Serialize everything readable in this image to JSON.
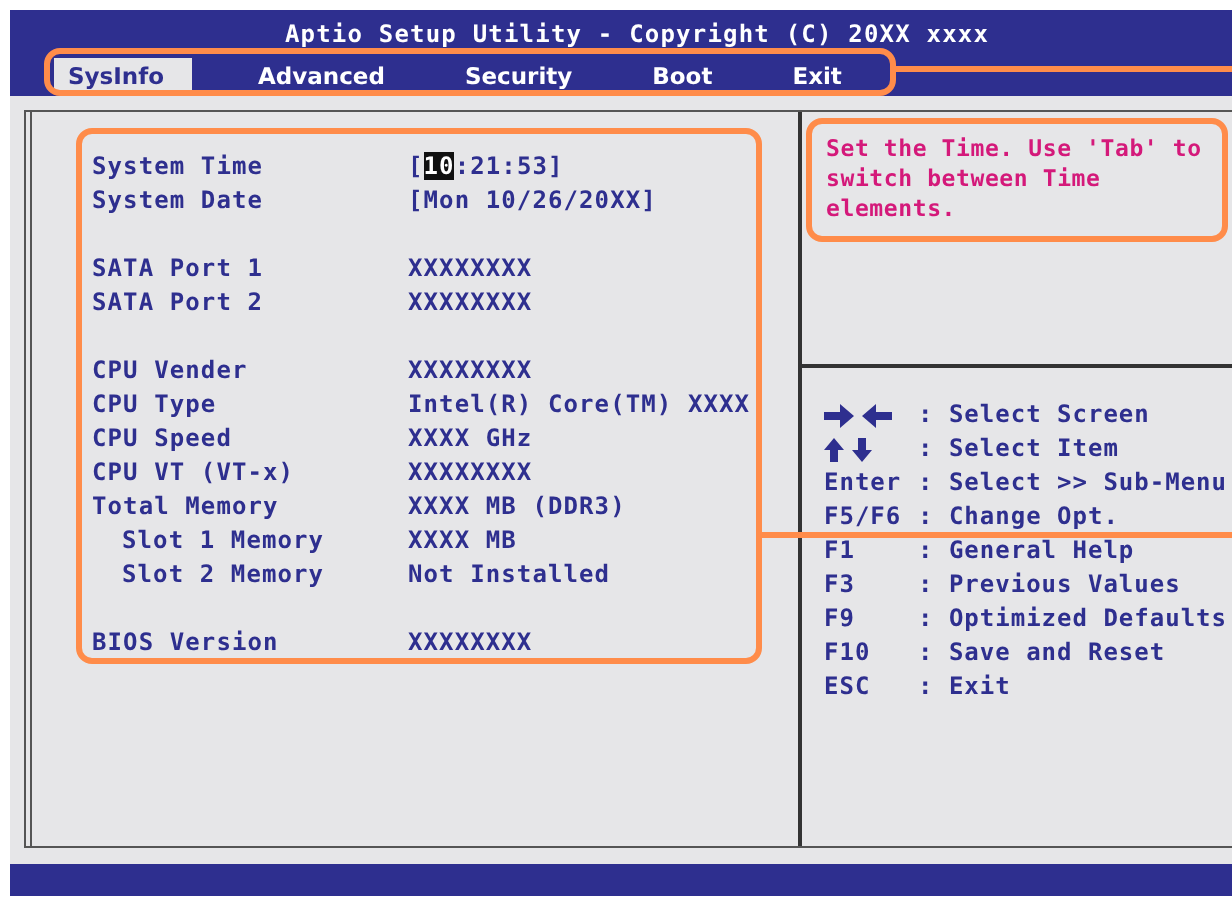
{
  "window": {
    "title": "Aptio Setup Utility - Copyright (C) 20XX xxxx"
  },
  "tabs": [
    {
      "label": "SysInfo",
      "selected": true
    },
    {
      "label": "Advanced",
      "selected": false
    },
    {
      "label": "Security",
      "selected": false
    },
    {
      "label": "Boot",
      "selected": false
    },
    {
      "label": "Exit",
      "selected": false
    }
  ],
  "info_groups": [
    [
      {
        "label": "System Time",
        "value_parts": [
          {
            "text": "[",
            "highlighted": false
          },
          {
            "text": "10",
            "highlighted": true
          },
          {
            "text": ":21:53]",
            "highlighted": false
          }
        ]
      },
      {
        "label": "System Date",
        "value_parts": [
          {
            "text": "[Mon 10/26/20XX]",
            "highlighted": false
          }
        ]
      }
    ],
    [
      {
        "label": "SATA Port 1",
        "value_parts": [
          {
            "text": "XXXXXXXX",
            "highlighted": false
          }
        ]
      },
      {
        "label": "SATA Port 2",
        "value_parts": [
          {
            "text": "XXXXXXXX",
            "highlighted": false
          }
        ]
      }
    ],
    [
      {
        "label": "CPU Vender",
        "value_parts": [
          {
            "text": "XXXXXXXX",
            "highlighted": false
          }
        ]
      },
      {
        "label": "CPU Type",
        "value_parts": [
          {
            "text": "Intel(R) Core(TM) XXXX",
            "highlighted": false
          }
        ]
      },
      {
        "label": "CPU Speed",
        "value_parts": [
          {
            "text": "XXXX GHz",
            "highlighted": false
          }
        ]
      },
      {
        "label": "CPU VT (VT-x)",
        "value_parts": [
          {
            "text": "XXXXXXXX",
            "highlighted": false
          }
        ]
      },
      {
        "label": "Total Memory",
        "value_parts": [
          {
            "text": "XXXX MB (DDR3)",
            "highlighted": false
          }
        ],
        "children": [
          {
            "label": "Slot 1 Memory",
            "value_parts": [
              {
                "text": "XXXX MB",
                "highlighted": false
              }
            ]
          },
          {
            "label": "Slot 2 Memory",
            "value_parts": [
              {
                "text": "Not Installed",
                "highlighted": false
              }
            ]
          }
        ]
      }
    ],
    [
      {
        "label": "BIOS Version",
        "value_parts": [
          {
            "text": "XXXXXXXX",
            "highlighted": false
          }
        ]
      }
    ]
  ],
  "help_text": "Set the Time. Use 'Tab' to switch between Time elements.",
  "keys": [
    {
      "kind": "arrows-horizontal",
      "action": ": Select Screen"
    },
    {
      "kind": "arrows-vertical",
      "action": ": Select Item"
    },
    {
      "kind": "text",
      "key": "Enter",
      "action": ": Select >> Sub-Menu"
    },
    {
      "kind": "text",
      "key": "F5/F6",
      "action": ": Change Opt."
    },
    {
      "kind": "text",
      "key": "F1",
      "action": ": General Help"
    },
    {
      "kind": "text",
      "key": "F3",
      "action": ": Previous Values"
    },
    {
      "kind": "text",
      "key": "F9",
      "action": ": Optimized Defaults"
    },
    {
      "kind": "text",
      "key": "F10",
      "action": ": Save and Reset"
    },
    {
      "kind": "text",
      "key": "ESC",
      "action": ": Exit"
    }
  ]
}
